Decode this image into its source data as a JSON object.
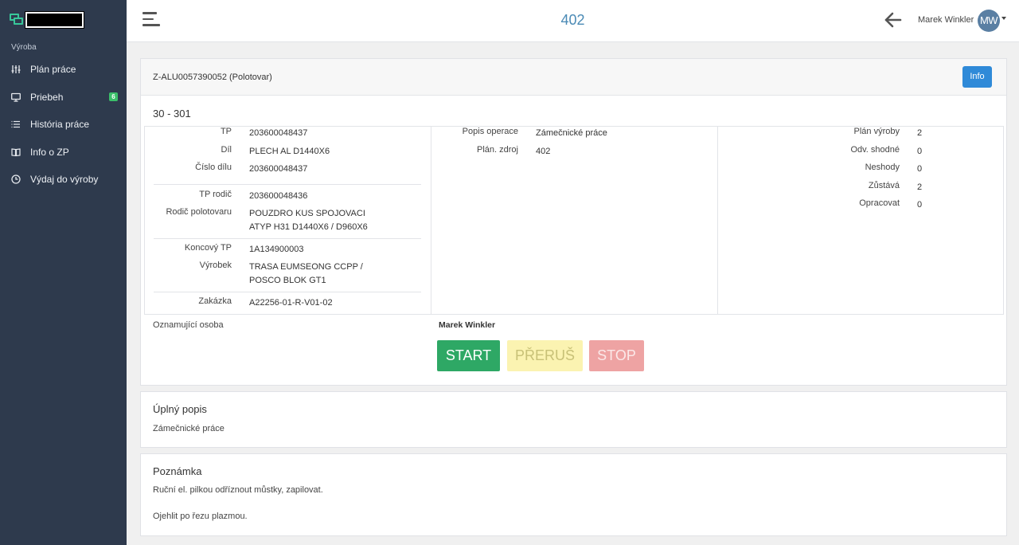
{
  "sidebar": {
    "section": "Výroba",
    "items": [
      {
        "label": "Plán práce",
        "icon": "sliders-icon"
      },
      {
        "label": "Priebeh",
        "icon": "monitor-icon",
        "badge": "6"
      },
      {
        "label": "História práce",
        "icon": "list-icon"
      },
      {
        "label": "Info o ZP",
        "icon": "book-icon"
      },
      {
        "label": "Výdaj do výroby",
        "icon": "clock-icon"
      }
    ]
  },
  "header": {
    "title": "402",
    "user_name": "Marek Winkler",
    "avatar_initials": "MW"
  },
  "main": {
    "card_title": "Z-ALU0057390052 (Polotovar)",
    "info_button": "Info",
    "operation_title": "30 - 301",
    "left": {
      "tp_label": "TP",
      "tp": "203600048437",
      "dil_label": "Díl",
      "dil": "PLECH AL D1440X6",
      "cislo_dilu_label": "Číslo dílu",
      "cislo_dilu": "203600048437",
      "tp_rodic_label": "TP rodič",
      "tp_rodic": "203600048436",
      "rodic_polotovaru_label": "Rodič polotovaru",
      "rodic_polotovaru_1": "POUZDRO KUS SPOJOVACI",
      "rodic_polotovaru_2": "ATYP H31 D1440X6 / D960X6",
      "koncovy_tp_label": "Koncový TP",
      "koncovy_tp": "1A134900003",
      "vyrobek_label": "Výrobek",
      "vyrobek_1": "TRASA EUMSEONG CCPP /",
      "vyrobek_2": "POSCO BLOK GT1",
      "zakazka_label": "Zakázka",
      "zakazka": "A22256-01-R-V01-02"
    },
    "middle": {
      "popis_operace_label": "Popis operace",
      "popis_operace": "Zámečnické práce",
      "plan_zdroj_label": "Plán. zdroj",
      "plan_zdroj": "402"
    },
    "right": {
      "plan_vyroby_label": "Plán výroby",
      "plan_vyroby": "2",
      "odv_shodne_label": "Odv. shodné",
      "odv_shodne": "0",
      "neshody_label": "Neshody",
      "neshody": "0",
      "zustava_label": "Zůstává",
      "zustava": "2",
      "opracovat_label": "Opracovat",
      "opracovat": "0"
    },
    "announcer_label": "Oznamující osoba",
    "announcer": "Marek Winkler",
    "buttons": {
      "start": "START",
      "pause": "PŘERUŠ",
      "stop": "STOP"
    },
    "colors": {
      "start": "#2ea865",
      "pause": "#fbf3b1",
      "stop": "#eea3a3",
      "info": "#2f8ad8",
      "sidebar": "#2e3a4d"
    }
  },
  "description": {
    "title": "Úplný popis",
    "text": "Zámečnické práce"
  },
  "note": {
    "title": "Poznámka",
    "line1": "Ruční el. pilkou odříznout můstky, zapilovat.",
    "line2": "Ojehlit po řezu plazmou."
  }
}
